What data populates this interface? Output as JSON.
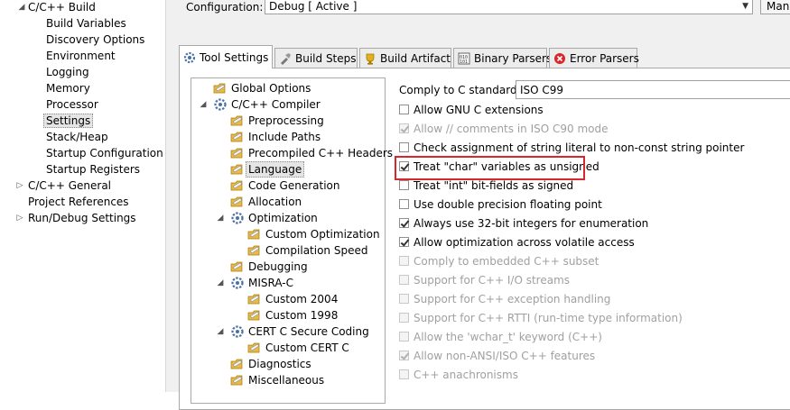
{
  "left_tree": {
    "items": [
      {
        "label": "C/C++ Build",
        "expanded": true
      },
      {
        "label": "Build Variables"
      },
      {
        "label": "Discovery Options"
      },
      {
        "label": "Environment"
      },
      {
        "label": "Logging"
      },
      {
        "label": "Memory"
      },
      {
        "label": "Processor"
      },
      {
        "label": "Settings",
        "selected": true
      },
      {
        "label": "Stack/Heap"
      },
      {
        "label": "Startup Configuration"
      },
      {
        "label": "Startup Registers"
      },
      {
        "label": "C/C++ General",
        "expanded": false
      },
      {
        "label": "Project References"
      },
      {
        "label": "Run/Debug Settings",
        "expanded": false
      }
    ]
  },
  "config": {
    "label": "Configuration:",
    "value": "Debug  [ Active ]",
    "manage_label": "Mana"
  },
  "tabs": [
    {
      "label": "Tool Settings",
      "icon": "tool-settings-icon",
      "active": true
    },
    {
      "label": "Build Steps",
      "icon": "build-steps-icon"
    },
    {
      "label": "Build Artifact",
      "icon": "build-artifact-icon"
    },
    {
      "label": "Binary Parsers",
      "icon": "binary-parsers-icon"
    },
    {
      "label": "Error Parsers",
      "icon": "error-parsers-icon"
    }
  ],
  "tool_tree": {
    "items": [
      {
        "label": "Global Options"
      },
      {
        "label": "C/C++ Compiler",
        "expanded": true
      },
      {
        "label": "Preprocessing"
      },
      {
        "label": "Include Paths"
      },
      {
        "label": "Precompiled C++ Headers"
      },
      {
        "label": "Language",
        "selected": true
      },
      {
        "label": "Code Generation"
      },
      {
        "label": "Allocation"
      },
      {
        "label": "Optimization",
        "expanded": true
      },
      {
        "label": "Custom Optimization"
      },
      {
        "label": "Compilation Speed"
      },
      {
        "label": "Debugging"
      },
      {
        "label": "MISRA-C",
        "expanded": true
      },
      {
        "label": "Custom 2004"
      },
      {
        "label": "Custom 1998"
      },
      {
        "label": "CERT C Secure Coding",
        "expanded": true
      },
      {
        "label": "Custom CERT C"
      },
      {
        "label": "Diagnostics"
      },
      {
        "label": "Miscellaneous"
      }
    ]
  },
  "comply": {
    "label": "Comply to C standard:",
    "value": "ISO C99"
  },
  "options": [
    {
      "label": "Allow GNU C extensions",
      "checked": false,
      "enabled": true
    },
    {
      "label": "Allow // comments in ISO C90 mode",
      "checked": true,
      "enabled": false
    },
    {
      "label": "Check assignment of string literal to non-const string pointer",
      "checked": false,
      "enabled": true
    },
    {
      "label": "Treat \"char\" variables as unsigned",
      "checked": true,
      "enabled": true,
      "highlighted": true
    },
    {
      "label": "Treat \"int\" bit-fields as signed",
      "checked": false,
      "enabled": true
    },
    {
      "label": "Use double precision floating point",
      "checked": false,
      "enabled": true
    },
    {
      "label": "Always use 32-bit integers for enumeration",
      "checked": true,
      "enabled": true
    },
    {
      "label": "Allow optimization across volatile access",
      "checked": true,
      "enabled": true
    },
    {
      "label": "Comply to embedded C++ subset",
      "checked": false,
      "enabled": false
    },
    {
      "label": "Support for C++ I/O streams",
      "checked": false,
      "enabled": false
    },
    {
      "label": "Support for C++ exception handling",
      "checked": false,
      "enabled": false
    },
    {
      "label": "Support for C++ RTTI (run-time type information)",
      "checked": false,
      "enabled": false
    },
    {
      "label": "Allow the 'wchar_t' keyword (C++)",
      "checked": false,
      "enabled": false
    },
    {
      "label": "Allow non-ANSI/ISO C++ features",
      "checked": true,
      "enabled": false
    },
    {
      "label": "C++ anachronisms",
      "checked": false,
      "enabled": false
    }
  ],
  "colors": {
    "highlight_border": "#d9262c",
    "panel_bg": "#f0f0f0",
    "folder_icon": "#e9b949"
  }
}
